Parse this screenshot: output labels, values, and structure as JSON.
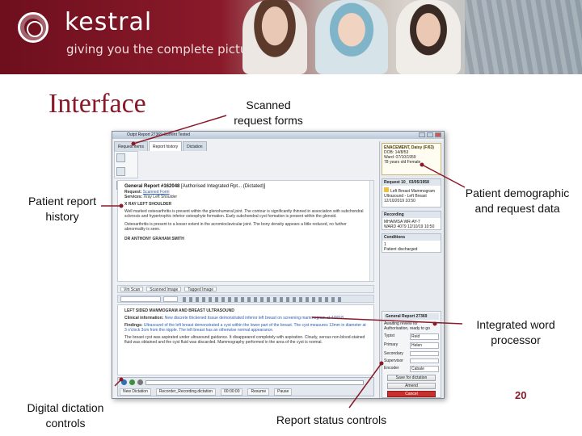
{
  "banner": {
    "logo_text": "kestral",
    "tagline": "giving you the complete picture"
  },
  "slide": {
    "title": "Interface",
    "page_number": "20"
  },
  "callouts": {
    "scanned": "Scanned request forms",
    "history": "Patient report history",
    "demographic": "Patient demographic and request data",
    "word": "Integrated word processor",
    "dictation": "Digital dictation controls",
    "status": "Report status controls"
  },
  "app": {
    "title": "Outpt Report 27369 Current Tested",
    "tabs": [
      "Request items",
      "Report history",
      "Dictation"
    ],
    "report": {
      "header": "General Report #162048",
      "header_note": "[Authorised Integrated Rpt... (Dictated)]",
      "request_label": "Request:",
      "request_value": "Scanned Form",
      "services_label": "Services:",
      "services_value": "Xray Left Shoulder",
      "exam_title": "X RAY LEFT SHOULDER",
      "para1": "Well marked osteoarthritis is present within the glenohumeral joint. The contour is significantly thinned in association with subchondral sclerosis and hypertrophic inferior osteophyte formation. Early subchondral cyst formation is present within the glenoid.",
      "para2": "Osteoarthritis is present to a lesser extent in the acromioclavicular joint. The bony density appears a little reduced, no further abnormality is seen.",
      "signature": "DR ANTHONY GRAHAM SMITH"
    },
    "attachments": [
      "Vm Scan",
      "Scanned Image",
      "Tagged Image"
    ],
    "editor": {
      "heading": "LEFT SIDED MAMMOGRAM AND BREAST ULTRASOUND",
      "clinical_label": "Clinical information:",
      "clinical_text": "New discrete thickened tissue demonstrated inferior left breast on screening mammogram at 4/2018.",
      "findings_label": "Findings:",
      "findings_text": "Ultrasound of the left breast demonstrated a cyst within the lower part of the breast. The cyst measures 13mm in diameter at 3 o'clock 3cm from the nipple. The left breast has an otherwise normal appearance.",
      "para": "The breast cyst was aspirated under ultrasound guidance. It disappeared completely with aspiration. Cloudy, serous non-blood-stained fluid was obtained and the cyst fluid was discarded. Mammography performed in the area of the cyst is normal."
    },
    "dictation": {
      "file": "Recorder_Recording.dictation",
      "time": "00:00:00",
      "buttons": [
        "New Dictation",
        "Resume",
        "Pause"
      ]
    },
    "demographic": {
      "name": "ENACEMENT, Daisy (F/63)",
      "dob": "DOB: 14/8/53",
      "location": "Ward: 07/10/1959",
      "sex": "78 years old Female"
    },
    "panels": [
      {
        "title": "Request 10_ 03/05/1958",
        "lines": [
          "Left Breast Mammogram",
          "Ultrasound - Left Breast",
          "12/10/2019 10:50"
        ]
      },
      {
        "title": "Recording",
        "lines": [
          "MHAIMSA WR-AY-7",
          "WARD 4079 12/10/19 10:50"
        ]
      },
      {
        "title": "Conditions",
        "lines": [
          "1",
          "Patient discharged"
        ]
      }
    ],
    "status_panel": {
      "title": "General Report 27369",
      "note": "Awaiting review for Authorisation, ready to go",
      "rows": [
        {
          "label": "Typist",
          "value": "Reid"
        },
        {
          "label": "Primary",
          "value": "Helen"
        },
        {
          "label": "Secondary",
          "value": ""
        },
        {
          "label": "Supervisor",
          "value": ""
        },
        {
          "label": "Encoder",
          "value": "Cabale"
        }
      ],
      "buttons": [
        "Save for dictation",
        "Amend",
        "Cancel"
      ]
    }
  },
  "colors": {
    "brand": "#8a1a2a",
    "connector": "#8a1a2a"
  }
}
